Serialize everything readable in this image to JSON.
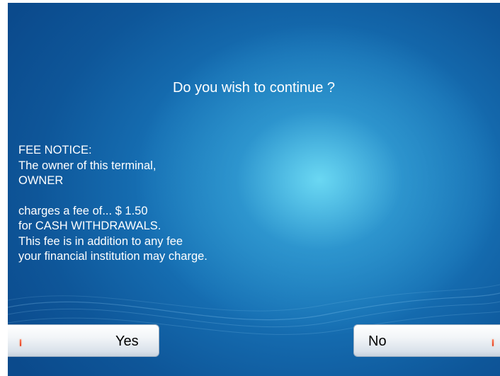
{
  "prompt": "Do you wish to continue ?",
  "fee_notice": {
    "heading": "FEE NOTICE:",
    "owner_line": "The owner of this terminal,",
    "owner_name": "OWNER",
    "fee_line": "charges a fee of... $ 1.50",
    "transaction_line": "for CASH WITHDRAWALS.",
    "addition_line": "This fee is in addition to any fee",
    "institution_line": "your financial institution may charge."
  },
  "buttons": {
    "yes_label": "Yes",
    "no_label": "No"
  },
  "colors": {
    "background_dark": "#0b4a8c",
    "background_mid": "#166fb3",
    "background_glow": "#6edcf5",
    "text": "#ffffff",
    "button_face": "#f2f5f8",
    "button_marker": "#e23c1e"
  }
}
